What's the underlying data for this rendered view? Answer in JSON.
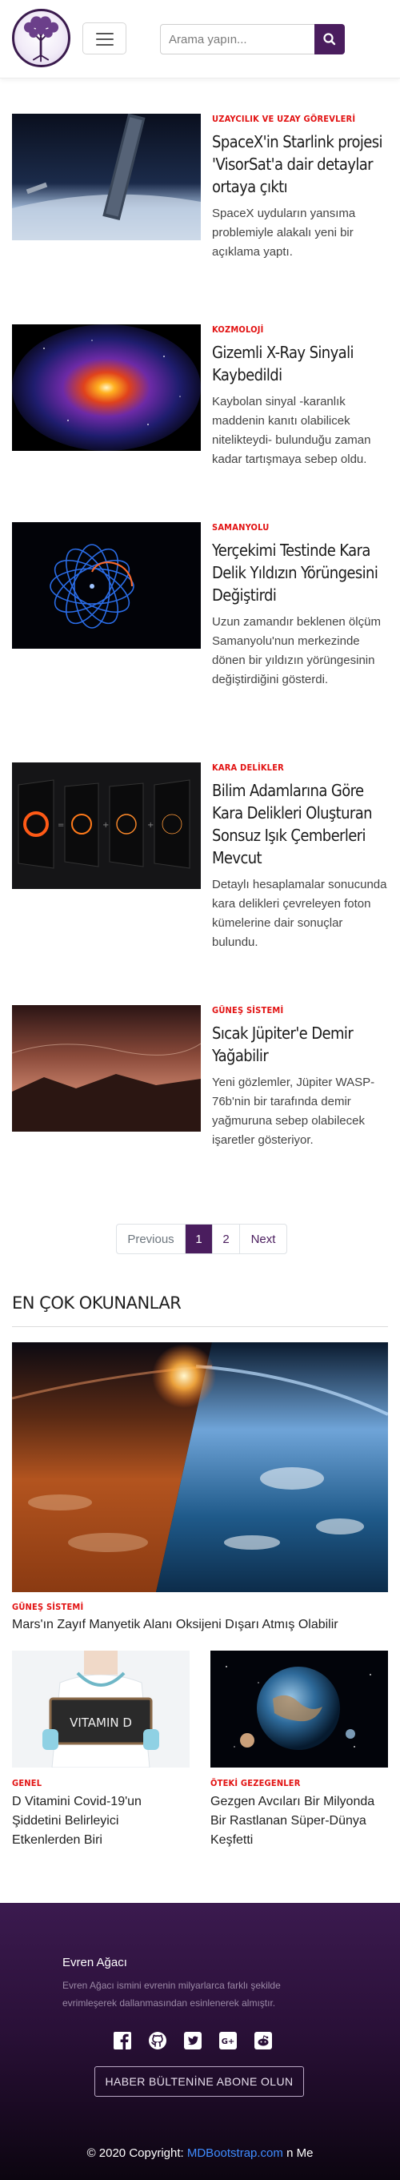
{
  "header": {
    "search_placeholder": "Arama yapın...",
    "brand_color": "#4a1d5e"
  },
  "articles": [
    {
      "category": "UZAYCILIK VE UZAY GÖREVLERİ",
      "title": "SpaceX'in Starlink projesi 'VisorSat'a dair detaylar ortaya çıktı",
      "description": "SpaceX uyduların yansıma problemiyle alakalı yeni bir açıklama yaptı."
    },
    {
      "category": "KOZMOLOJİ",
      "title": "Gizemli X-Ray Sinyali Kaybedildi",
      "description": "Kaybolan sinyal -karanlık maddenin kanıtı olabilicek nitelikteydi- bulunduğu zaman kadar tartışmaya sebep oldu."
    },
    {
      "category": "SAMANYOLU",
      "title": "Yerçekimi Testinde Kara Delik Yıldızın Yörüngesini Değiştirdi",
      "description": "Uzun zamandır beklenen ölçüm Samanyolu'nun merkezinde dönen bir yıldızın yörüngesinin değiştirdiğini gösterdi."
    },
    {
      "category": "KARA DELİKLER",
      "title": "Bilim Adamlarına Göre Kara Delikleri Oluşturan Sonsuz Işık Çemberleri Mevcut",
      "description": "Detaylı hesaplamalar sonucunda kara delikleri çevreleyen foton kümelerine dair sonuçlar bulundu."
    },
    {
      "category": "GÜNEŞ SİSTEMİ",
      "title": "Sıcak Jüpiter'e Demir Yağabilir",
      "description": "Yeni gözlemler, Jüpiter WASP-76b'nin bir tarafında demir yağmuruna sebep olabilecek işaretler gösteriyor."
    }
  ],
  "pagination": {
    "previous": "Previous",
    "page1": "1",
    "page2": "2",
    "next": "Next"
  },
  "most_read": {
    "heading": "EN ÇOK OKUNANLAR",
    "featured": {
      "category": "GÜNEŞ SİSTEMİ",
      "title": "Mars'ın Zayıf Manyetik Alanı Oksijeni Dışarı Atmış Olabilir"
    },
    "cards": [
      {
        "image_text": "VITAMIN D",
        "category": "GENEL",
        "title": "D Vitamini Covid-19'un Şiddetini Belirleyici Etkenlerden Biri"
      },
      {
        "category": "ÖTEKİ GEZEGENLER",
        "title": "Gezgen Avcıları Bir Milyonda Bir Rastlanan Süper-Dünya Keşfetti"
      }
    ]
  },
  "footer": {
    "title": "Evren Ağacı",
    "text": "Evren Ağacı ismini evrenin milyarlarca farklı şekilde evrimleşerek dallanmasından esinlenerek almıştır.",
    "socials": [
      "facebook-icon",
      "github-icon",
      "twitter-icon",
      "google-plus-icon",
      "reddit-icon"
    ],
    "subscribe": "HABER BÜLTENİNE ABONE OLUN",
    "copyright_prefix": "© 2020 Copyright: ",
    "copyright_link": "MDBootstrap.com",
    "copyright_suffix": " n Me"
  }
}
